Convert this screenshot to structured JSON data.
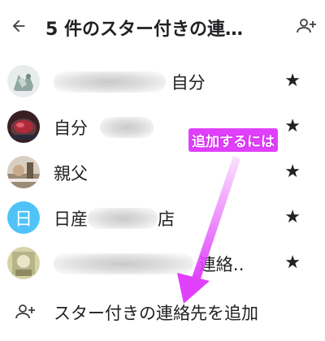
{
  "header": {
    "back_icon": "arrow-back-icon",
    "title": "5 件のスター付きの連…",
    "add_contact_icon": "person-add-icon"
  },
  "contacts": [
    {
      "name_suffix": "自分",
      "star": "★"
    },
    {
      "name_prefix": "自分",
      "star": "★"
    },
    {
      "name_prefix": "親父",
      "star": "★"
    },
    {
      "avatar_letter": "日",
      "name_prefix": "日産",
      "name_suffix": "店",
      "star": "★"
    },
    {
      "name_suffix": "連絡‥",
      "star": "★"
    }
  ],
  "add_row": {
    "label": "スター付きの連絡先を追加",
    "icon": "person-add-icon"
  },
  "annotation": {
    "callout": "追加するには",
    "color": "#e040fb"
  },
  "colors": {
    "accent_magenta": "#e040fb",
    "avatar_letter_bg": "#4fc3f7"
  }
}
